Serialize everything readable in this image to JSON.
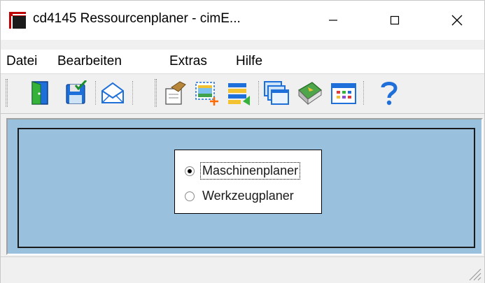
{
  "window": {
    "title": "cd4145 Ressourcenplaner - cimE...",
    "icon": "app-icon",
    "controls": {
      "minimize": "minimize-icon",
      "maximize": "maximize-icon",
      "close": "close-icon"
    }
  },
  "menu": {
    "items": [
      {
        "label": "Datei"
      },
      {
        "label": "Bearbeiten"
      },
      {
        "label": "Extras"
      },
      {
        "label": "Hilfe"
      }
    ]
  },
  "toolbar": {
    "buttons": [
      {
        "icon": "exit-door-icon"
      },
      {
        "icon": "save-icon"
      },
      {
        "icon": "mail-icon"
      },
      {
        "icon": "edit-document-icon"
      },
      {
        "icon": "add-selection-icon"
      },
      {
        "icon": "list-import-icon"
      },
      {
        "icon": "windows-cascade-icon"
      },
      {
        "icon": "book-icon"
      },
      {
        "icon": "calendar-grid-icon"
      },
      {
        "icon": "help-icon"
      }
    ]
  },
  "planner_choice": {
    "options": [
      {
        "label": "Maschinenplaner",
        "selected": true
      },
      {
        "label": "Werkzeugplaner",
        "selected": false
      }
    ]
  },
  "statusbar": {
    "text": ""
  },
  "colors": {
    "client_background": "#99c1dd",
    "accent_blue": "#1e6fd9"
  }
}
